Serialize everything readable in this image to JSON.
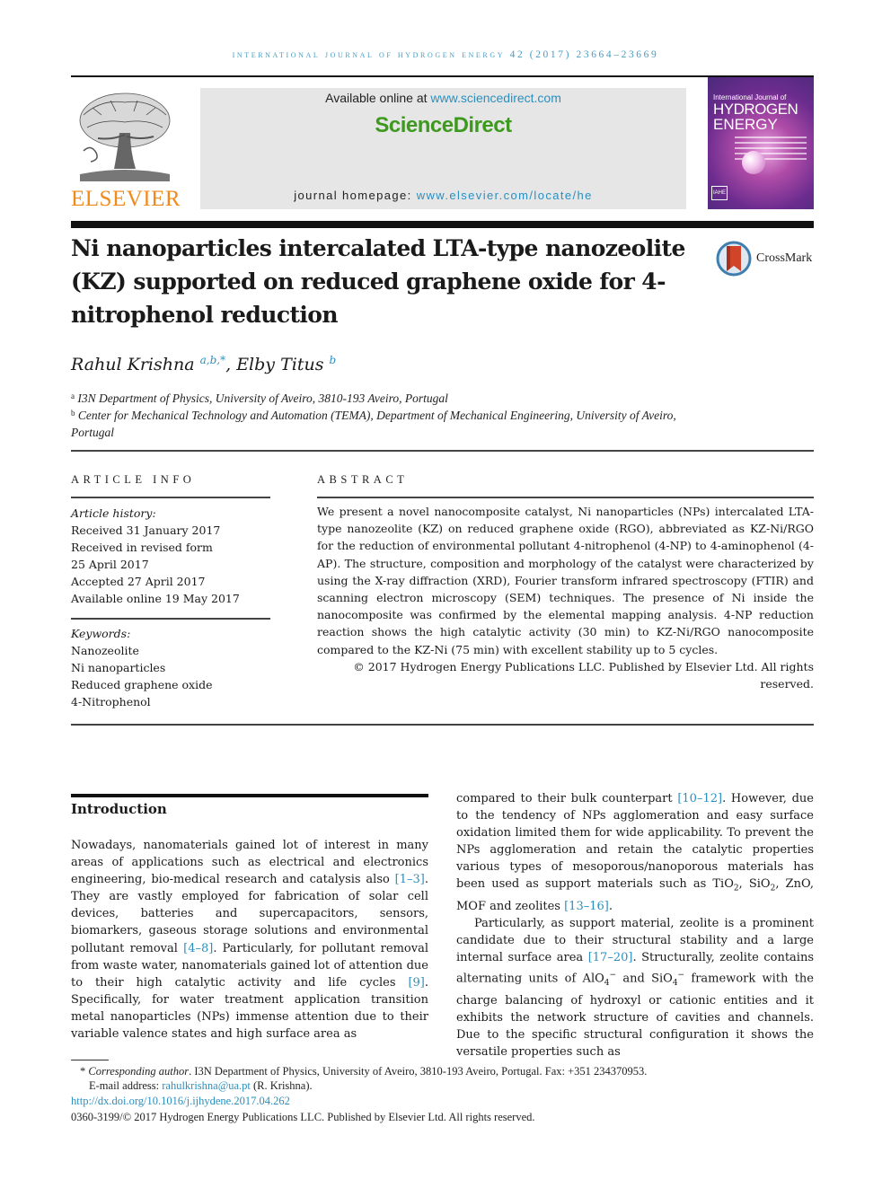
{
  "running_head": "INTERNATIONAL JOURNAL OF HYDROGEN ENERGY 42 (2017) 23664–23669",
  "publisher": {
    "logo_icon": "elsevier-tree-icon",
    "name": "ELSEVIER"
  },
  "sciencedirect": {
    "available_prefix": "Available online at ",
    "available_link": "www.sciencedirect.com",
    "brand": "ScienceDirect",
    "homepage_prefix": "journal homepage: ",
    "homepage_link": "www.elsevier.com/locate/he"
  },
  "cover": {
    "line1": "International Journal of",
    "line2": "HYDROGEN",
    "line3": "ENERGY",
    "badge": "IAHE"
  },
  "article": {
    "title": "Ni nanoparticles intercalated LTA-type nanozeolite (KZ) supported on reduced graphene oxide for 4-nitrophenol reduction",
    "crossmark_label": "CrossMark",
    "authors": [
      {
        "name": "Rahul Krishna",
        "sup": "a,b,*"
      },
      {
        "name": "Elby Titus",
        "sup": "b"
      }
    ],
    "author_separator": ", ",
    "affiliations": [
      {
        "mark": "a",
        "text": "I3N Department of Physics, University of Aveiro, 3810-193 Aveiro, Portugal"
      },
      {
        "mark": "b",
        "text": "Center for Mechanical Technology and Automation (TEMA), Department of Mechanical Engineering, University of Aveiro, Portugal"
      }
    ]
  },
  "article_info": {
    "heading": "ARTICLE INFO",
    "history_label": "Article history:",
    "history": [
      "Received 31 January 2017",
      "Received in revised form",
      "25 April 2017",
      "Accepted 27 April 2017",
      "Available online 19 May 2017"
    ],
    "keywords_label": "Keywords:",
    "keywords": [
      "Nanozeolite",
      "Ni nanoparticles",
      "Reduced graphene oxide",
      "4-Nitrophenol"
    ]
  },
  "abstract": {
    "heading": "ABSTRACT",
    "text": "We present a novel nanocomposite catalyst, Ni nanoparticles (NPs) intercalated LTA-type nanozeolite (KZ) on reduced graphene oxide (RGO), abbreviated as KZ-Ni/RGO for the reduction of environmental pollutant 4-nitrophenol (4-NP) to 4-aminophenol (4-AP). The structure, composition and morphology of the catalyst were characterized by using the X-ray diffraction (XRD), Fourier transform infrared spectroscopy (FTIR) and scanning electron microscopy (SEM) techniques. The presence of Ni inside the nanocomposite was confirmed by the elemental mapping analysis. 4-NP reduction reaction shows the high catalytic activity (30 min) to KZ-Ni/RGO nanocomposite compared to the KZ-Ni (75 min) with excellent stability up to 5 cycles.",
    "copyright": "© 2017 Hydrogen Energy Publications LLC. Published by Elsevier Ltd. All rights reserved."
  },
  "introduction": {
    "heading": "Introduction",
    "col1": {
      "t1": "Nowadays, nanomaterials gained lot of interest in many areas of applications such as electrical and electronics engineering, bio-medical research and catalysis also ",
      "c1": "[1–3]",
      "t2": ". They are vastly employed for fabrication of solar cell devices, batteries and supercapacitors, sensors, biomarkers, gaseous storage solutions and environmental pollutant removal ",
      "c2": "[4–8]",
      "t3": ". Particularly, for pollutant removal from waste water, nanomaterials gained lot of attention due to their high catalytic activity and life cycles ",
      "c3": "[9]",
      "t4": ". Specifically, for water treatment application transition metal nanoparticles (NPs) immense attention due to their variable valence states and high surface area as"
    },
    "col2_p1": {
      "t1": "compared to their bulk counterpart ",
      "c1": "[10–12]",
      "t2": ". However, due to the tendency of NPs agglomeration and easy surface oxidation limited them for wide applicability. To prevent the NPs agglomeration and retain the catalytic properties various types of mesoporous/nanoporous materials has been used as support materials such as TiO",
      "sub1": "2",
      "t3": ", SiO",
      "sub2": "2",
      "t4": ", ZnO, MOF and zeolites ",
      "c2": "[13–16]",
      "t5": "."
    },
    "col2_p2": {
      "t1": "Particularly, as support material, zeolite is a prominent candidate due to their structural stability and a large internal surface area ",
      "c1": "[17–20]",
      "t2": ". Structurally, zeolite contains alternating units of AlO",
      "sub1": "4",
      "sup1": "−",
      "t3": " and SiO",
      "sub2": "4",
      "sup2": "−",
      "t4": " framework with the charge balancing of hydroxyl or cationic entities and it exhibits the network structure of cavities and channels. Due to the specific structural configuration it shows the versatile properties such as"
    }
  },
  "footnotes": {
    "star": "*",
    "corr_label": "Corresponding author",
    "corr_text": ". I3N Department of Physics, University of Aveiro, 3810-193 Aveiro, Portugal. Fax: +351 234370953.",
    "email_label": "E-mail address: ",
    "email": "rahulkrishna@ua.pt",
    "email_suffix": " (R. Krishna).",
    "doi": "http://dx.doi.org/10.1016/j.ijhydene.2017.04.262",
    "issn_line": "0360-3199/© 2017 Hydrogen Energy Publications LLC. Published by Elsevier Ltd. All rights reserved."
  },
  "colors": {
    "link": "#2b8fbf",
    "elsevier_orange": "#f28a1b",
    "sciencedirect_green": "#3d9a1e",
    "running_head": "#4a9cc0"
  }
}
